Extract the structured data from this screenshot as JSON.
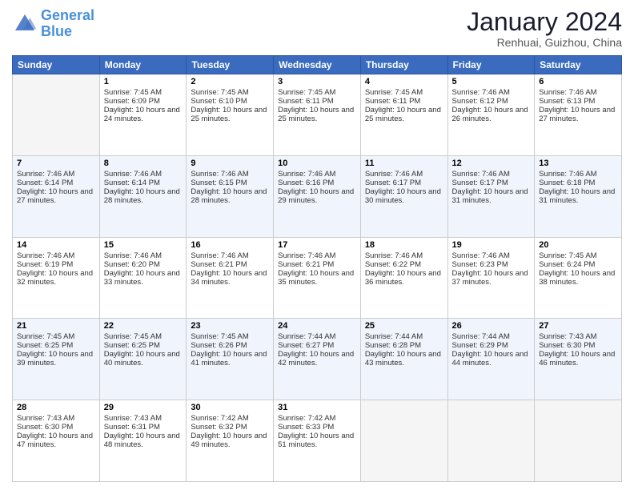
{
  "header": {
    "logo_line1": "General",
    "logo_line2": "Blue",
    "month_year": "January 2024",
    "location": "Renhuai, Guizhou, China"
  },
  "days_of_week": [
    "Sunday",
    "Monday",
    "Tuesday",
    "Wednesday",
    "Thursday",
    "Friday",
    "Saturday"
  ],
  "weeks": [
    [
      {
        "day": "",
        "empty": true
      },
      {
        "day": "1",
        "sunrise": "Sunrise: 7:45 AM",
        "sunset": "Sunset: 6:09 PM",
        "daylight": "Daylight: 10 hours and 24 minutes."
      },
      {
        "day": "2",
        "sunrise": "Sunrise: 7:45 AM",
        "sunset": "Sunset: 6:10 PM",
        "daylight": "Daylight: 10 hours and 25 minutes."
      },
      {
        "day": "3",
        "sunrise": "Sunrise: 7:45 AM",
        "sunset": "Sunset: 6:11 PM",
        "daylight": "Daylight: 10 hours and 25 minutes."
      },
      {
        "day": "4",
        "sunrise": "Sunrise: 7:45 AM",
        "sunset": "Sunset: 6:11 PM",
        "daylight": "Daylight: 10 hours and 25 minutes."
      },
      {
        "day": "5",
        "sunrise": "Sunrise: 7:46 AM",
        "sunset": "Sunset: 6:12 PM",
        "daylight": "Daylight: 10 hours and 26 minutes."
      },
      {
        "day": "6",
        "sunrise": "Sunrise: 7:46 AM",
        "sunset": "Sunset: 6:13 PM",
        "daylight": "Daylight: 10 hours and 27 minutes."
      }
    ],
    [
      {
        "day": "7",
        "sunrise": "Sunrise: 7:46 AM",
        "sunset": "Sunset: 6:14 PM",
        "daylight": "Daylight: 10 hours and 27 minutes."
      },
      {
        "day": "8",
        "sunrise": "Sunrise: 7:46 AM",
        "sunset": "Sunset: 6:14 PM",
        "daylight": "Daylight: 10 hours and 28 minutes."
      },
      {
        "day": "9",
        "sunrise": "Sunrise: 7:46 AM",
        "sunset": "Sunset: 6:15 PM",
        "daylight": "Daylight: 10 hours and 28 minutes."
      },
      {
        "day": "10",
        "sunrise": "Sunrise: 7:46 AM",
        "sunset": "Sunset: 6:16 PM",
        "daylight": "Daylight: 10 hours and 29 minutes."
      },
      {
        "day": "11",
        "sunrise": "Sunrise: 7:46 AM",
        "sunset": "Sunset: 6:17 PM",
        "daylight": "Daylight: 10 hours and 30 minutes."
      },
      {
        "day": "12",
        "sunrise": "Sunrise: 7:46 AM",
        "sunset": "Sunset: 6:17 PM",
        "daylight": "Daylight: 10 hours and 31 minutes."
      },
      {
        "day": "13",
        "sunrise": "Sunrise: 7:46 AM",
        "sunset": "Sunset: 6:18 PM",
        "daylight": "Daylight: 10 hours and 31 minutes."
      }
    ],
    [
      {
        "day": "14",
        "sunrise": "Sunrise: 7:46 AM",
        "sunset": "Sunset: 6:19 PM",
        "daylight": "Daylight: 10 hours and 32 minutes."
      },
      {
        "day": "15",
        "sunrise": "Sunrise: 7:46 AM",
        "sunset": "Sunset: 6:20 PM",
        "daylight": "Daylight: 10 hours and 33 minutes."
      },
      {
        "day": "16",
        "sunrise": "Sunrise: 7:46 AM",
        "sunset": "Sunset: 6:21 PM",
        "daylight": "Daylight: 10 hours and 34 minutes."
      },
      {
        "day": "17",
        "sunrise": "Sunrise: 7:46 AM",
        "sunset": "Sunset: 6:21 PM",
        "daylight": "Daylight: 10 hours and 35 minutes."
      },
      {
        "day": "18",
        "sunrise": "Sunrise: 7:46 AM",
        "sunset": "Sunset: 6:22 PM",
        "daylight": "Daylight: 10 hours and 36 minutes."
      },
      {
        "day": "19",
        "sunrise": "Sunrise: 7:46 AM",
        "sunset": "Sunset: 6:23 PM",
        "daylight": "Daylight: 10 hours and 37 minutes."
      },
      {
        "day": "20",
        "sunrise": "Sunrise: 7:45 AM",
        "sunset": "Sunset: 6:24 PM",
        "daylight": "Daylight: 10 hours and 38 minutes."
      }
    ],
    [
      {
        "day": "21",
        "sunrise": "Sunrise: 7:45 AM",
        "sunset": "Sunset: 6:25 PM",
        "daylight": "Daylight: 10 hours and 39 minutes."
      },
      {
        "day": "22",
        "sunrise": "Sunrise: 7:45 AM",
        "sunset": "Sunset: 6:25 PM",
        "daylight": "Daylight: 10 hours and 40 minutes."
      },
      {
        "day": "23",
        "sunrise": "Sunrise: 7:45 AM",
        "sunset": "Sunset: 6:26 PM",
        "daylight": "Daylight: 10 hours and 41 minutes."
      },
      {
        "day": "24",
        "sunrise": "Sunrise: 7:44 AM",
        "sunset": "Sunset: 6:27 PM",
        "daylight": "Daylight: 10 hours and 42 minutes."
      },
      {
        "day": "25",
        "sunrise": "Sunrise: 7:44 AM",
        "sunset": "Sunset: 6:28 PM",
        "daylight": "Daylight: 10 hours and 43 minutes."
      },
      {
        "day": "26",
        "sunrise": "Sunrise: 7:44 AM",
        "sunset": "Sunset: 6:29 PM",
        "daylight": "Daylight: 10 hours and 44 minutes."
      },
      {
        "day": "27",
        "sunrise": "Sunrise: 7:43 AM",
        "sunset": "Sunset: 6:30 PM",
        "daylight": "Daylight: 10 hours and 46 minutes."
      }
    ],
    [
      {
        "day": "28",
        "sunrise": "Sunrise: 7:43 AM",
        "sunset": "Sunset: 6:30 PM",
        "daylight": "Daylight: 10 hours and 47 minutes."
      },
      {
        "day": "29",
        "sunrise": "Sunrise: 7:43 AM",
        "sunset": "Sunset: 6:31 PM",
        "daylight": "Daylight: 10 hours and 48 minutes."
      },
      {
        "day": "30",
        "sunrise": "Sunrise: 7:42 AM",
        "sunset": "Sunset: 6:32 PM",
        "daylight": "Daylight: 10 hours and 49 minutes."
      },
      {
        "day": "31",
        "sunrise": "Sunrise: 7:42 AM",
        "sunset": "Sunset: 6:33 PM",
        "daylight": "Daylight: 10 hours and 51 minutes."
      },
      {
        "day": "",
        "empty": true
      },
      {
        "day": "",
        "empty": true
      },
      {
        "day": "",
        "empty": true
      }
    ]
  ]
}
